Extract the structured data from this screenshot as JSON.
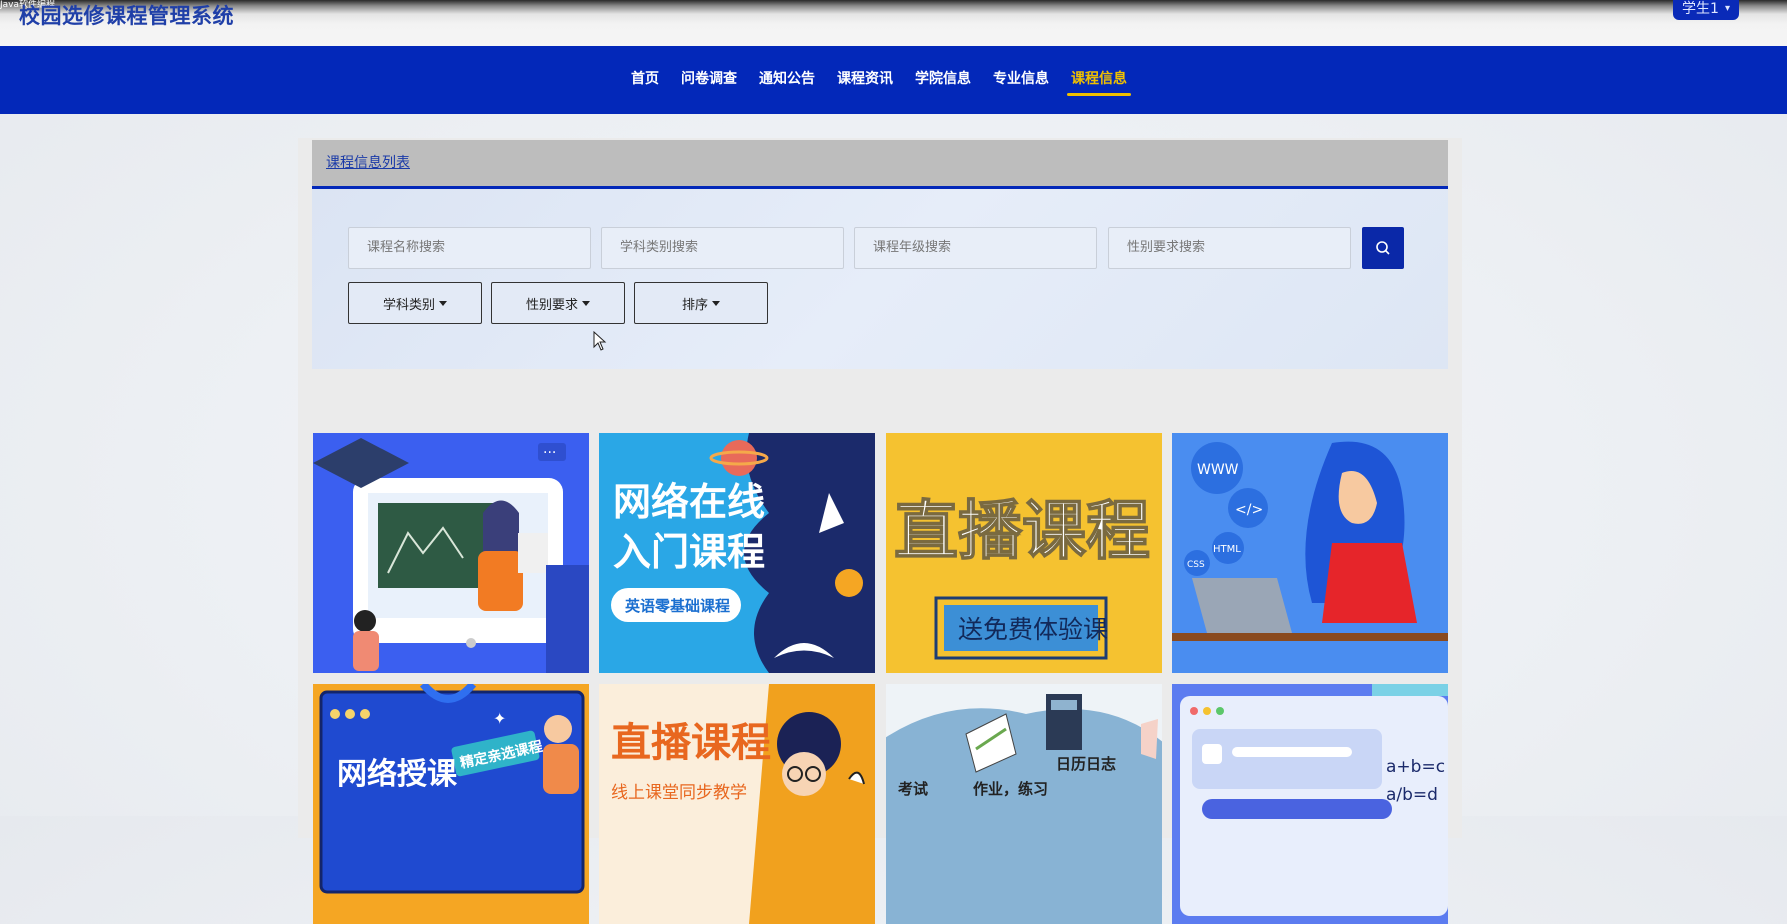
{
  "header": {
    "caption": "Java软件编程",
    "system_title": "校园选修课程管理系统",
    "user_label": "学生1"
  },
  "nav": {
    "items": [
      {
        "label": "首页",
        "active": false
      },
      {
        "label": "问卷调查",
        "active": false
      },
      {
        "label": "通知公告",
        "active": false
      },
      {
        "label": "课程资讯",
        "active": false
      },
      {
        "label": "学院信息",
        "active": false
      },
      {
        "label": "专业信息",
        "active": false
      },
      {
        "label": "课程信息",
        "active": true
      }
    ]
  },
  "list": {
    "title": "课程信息列表"
  },
  "search": {
    "placeholders": [
      "课程名称搜索",
      "学科类别搜索",
      "课程年级搜索",
      "性别要求搜索"
    ],
    "dropdowns": [
      "学科类别",
      "性别要求",
      "排序"
    ]
  },
  "cards": [
    {
      "image": "online-class-teacher-illustration",
      "texts": []
    },
    {
      "image": "online-course-banner",
      "texts": [
        "网络在线",
        "入门课程",
        "英语零基础课程"
      ]
    },
    {
      "image": "live-course-banner",
      "texts": [
        "直播课程",
        "送免费体验课"
      ]
    },
    {
      "image": "web-developer-illustration",
      "texts": [
        "WWW",
        "</>",
        "HTML",
        "CSS"
      ]
    },
    {
      "image": "online-teaching-banner",
      "texts": [
        "网络授课",
        "精定亲选课程"
      ]
    },
    {
      "image": "live-class-banner",
      "texts": [
        "直播课程",
        "线上课堂同步教学"
      ]
    },
    {
      "image": "study-tools-illustration",
      "texts": [
        "日历日志",
        "考试",
        "作业，练习"
      ]
    },
    {
      "image": "math-window-illustration",
      "texts": [
        "a+b=c",
        "a/b=d"
      ]
    }
  ],
  "colors": {
    "nav_bg": "#0328b9",
    "nav_active": "#f0c000",
    "search_button": "#0a28a8"
  }
}
